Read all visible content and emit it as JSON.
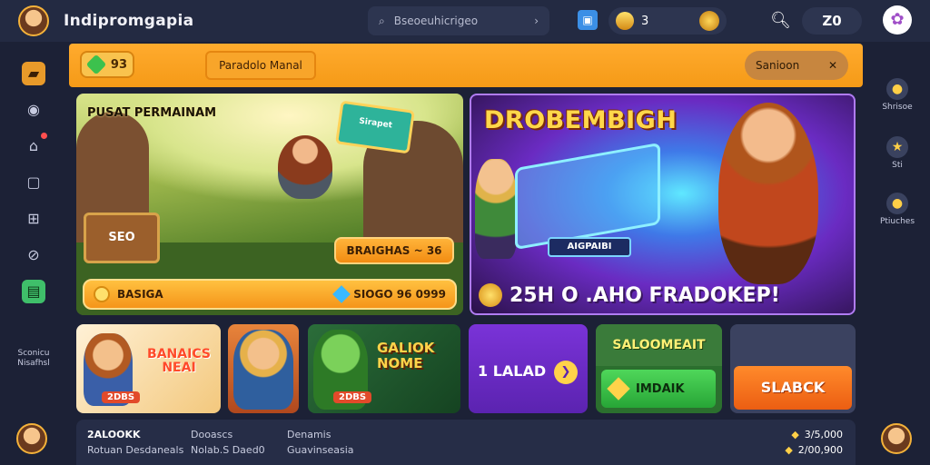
{
  "header": {
    "title": "Indipromgapia",
    "search_placeholder": "Bseoeuhicrigeo",
    "gems": "3",
    "score": "Z0"
  },
  "left_sidebar": {
    "bottom_label": "Sconicu Nisafhsl"
  },
  "right_sidebar": {
    "items": [
      {
        "label": "Shrisoe"
      },
      {
        "label": "Sti"
      },
      {
        "label": "Ptiuches"
      }
    ]
  },
  "notice": {
    "gem_count": "93",
    "tab_label": "Paradolo Manal",
    "right_label": "Sanioon"
  },
  "featured_left": {
    "title": "PUSAT PERMAINAM",
    "sign_text": "Sirapet",
    "chest_value": "SEO",
    "reward_pill": "BRAIGHAS ~ 36",
    "button_label": "BASIGA",
    "button_price": "SIOGO 96 0999"
  },
  "featured_right": {
    "title": "DROBEMBIGH",
    "box_label": "AIGPAIBI",
    "bottom_prefix": "25H",
    "bottom_text": "O .AHO FRADOKEP!"
  },
  "small_cards": {
    "card1_text": "BANAICS NEAI",
    "card1_tag": "2DBS",
    "card3_text": "GALIOK NOME",
    "card3_tag": "2DBS",
    "card4_label": "1 LALAD",
    "card5_title": "SALOOMEAIT",
    "card5_button": "IMDAIK",
    "card6_button": "SLABCK"
  },
  "stats": {
    "col1": {
      "head": "2ALOOKK",
      "sub": "Rotuan Desdaneals"
    },
    "col2": {
      "head": "Dooascs",
      "sub": "Nolab.S Daed0"
    },
    "col3": {
      "head": "Denamis",
      "sub": "Guavinseasia"
    },
    "right1": "3/5,000",
    "right2": "2/00,900"
  },
  "colors": {
    "background": "#1c2136",
    "accent_orange": "#f59a17",
    "accent_purple": "#7a33d8",
    "accent_green": "#27a536"
  }
}
